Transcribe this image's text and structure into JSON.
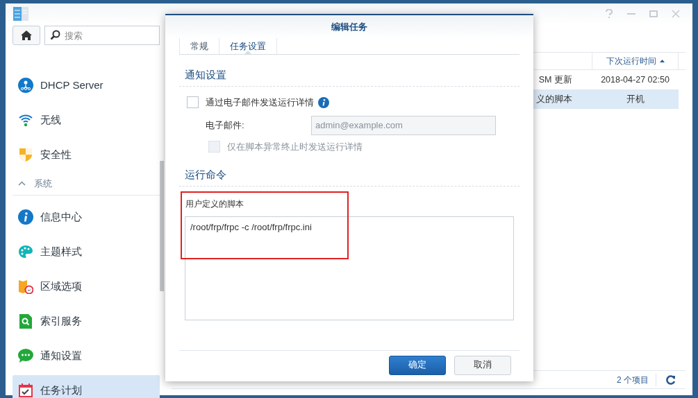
{
  "sidebar": {
    "search": {
      "placeholder": "搜索"
    },
    "items": [
      {
        "kind": "item",
        "label": "DHCP Server",
        "selected": false
      },
      {
        "kind": "item",
        "label": "无线",
        "selected": false
      },
      {
        "kind": "item",
        "label": "安全性",
        "selected": false
      },
      {
        "kind": "section",
        "label": "系统",
        "expanded": true
      },
      {
        "kind": "item",
        "label": "信息中心",
        "selected": false
      },
      {
        "kind": "item",
        "label": "主题样式",
        "selected": false
      },
      {
        "kind": "item",
        "label": "区域选项",
        "selected": false
      },
      {
        "kind": "item",
        "label": "索引服务",
        "selected": false
      },
      {
        "kind": "item",
        "label": "通知设置",
        "selected": false
      },
      {
        "kind": "item",
        "label": "任务计划",
        "selected": true
      }
    ]
  },
  "table": {
    "columns": [
      "",
      "下次运行时间"
    ],
    "rows": [
      {
        "cells": [
          "SM 更新",
          "2018-04-27 02:50"
        ],
        "selected": false
      },
      {
        "cells": [
          "义的脚本",
          "开机"
        ],
        "selected": true
      }
    ],
    "status": "2 个项目"
  },
  "dialog": {
    "title": "编辑任务",
    "tabs": [
      {
        "label": "常规",
        "selected": false
      },
      {
        "label": "任务设置",
        "selected": true
      }
    ],
    "notification": {
      "heading": "通知设置",
      "email_checkbox": {
        "label": "通过电子邮件发送运行详情",
        "checked": false,
        "disabled": false
      },
      "email_label": "电子邮件:",
      "email_placeholder": "admin@example.com",
      "abnormal_checkbox": {
        "label": "仅在脚本异常终止时发送运行详情",
        "checked": false,
        "disabled": true
      }
    },
    "command": {
      "heading": "运行命令",
      "label": "用户定义的脚本",
      "script": "/root/frp/frpc -c /root/frp/frpc.ini"
    },
    "buttons": [
      {
        "label": "确定",
        "kind": "primary"
      },
      {
        "label": "取消",
        "kind": "secondary"
      }
    ]
  }
}
